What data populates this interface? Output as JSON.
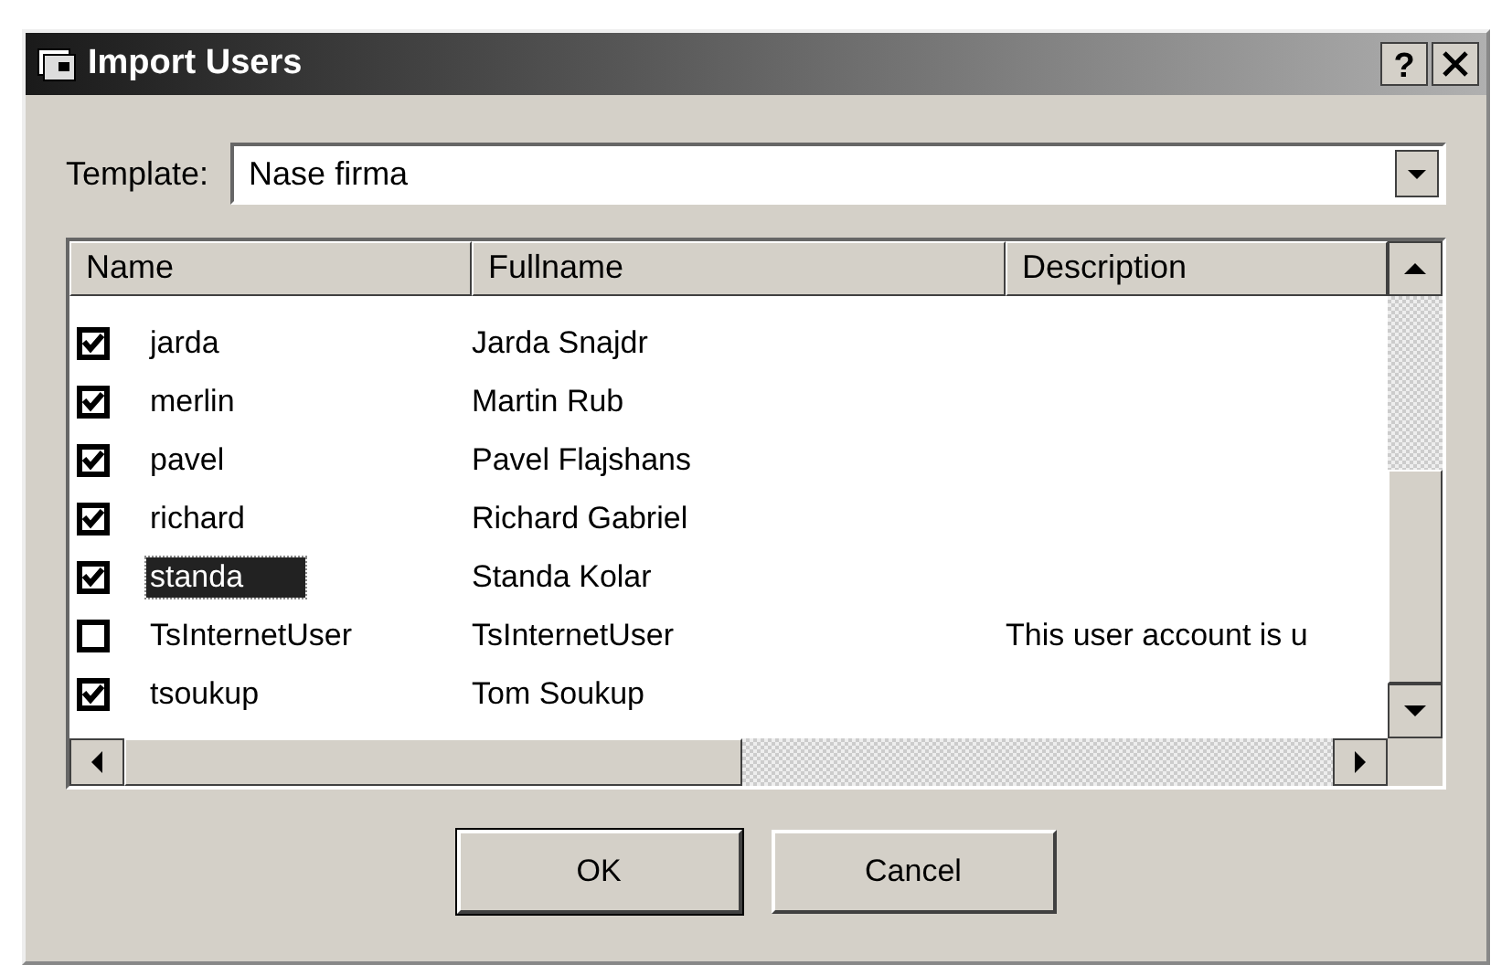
{
  "window": {
    "title": "Import Users",
    "help_button": "?"
  },
  "template": {
    "label": "Template:",
    "value": "Nase firma"
  },
  "table": {
    "columns": [
      "Name",
      "Fullname",
      "Description"
    ],
    "rows": [
      {
        "name": "jarda",
        "fullname": "Jarda Snajdr",
        "checked": true,
        "selected": false
      },
      {
        "name": "merlin",
        "fullname": "Martin Rub",
        "checked": true,
        "selected": false
      },
      {
        "name": "pavel",
        "fullname": "Pavel Flajshans",
        "checked": true,
        "selected": false
      },
      {
        "name": "richard",
        "fullname": "Richard Gabriel",
        "checked": true,
        "selected": false
      },
      {
        "name": "standa",
        "fullname": "Standa Kolar",
        "checked": true,
        "selected": true
      },
      {
        "name": "TsInternetUser",
        "fullname": "TsInternetUser",
        "description": "This user account is u",
        "checked": false,
        "selected": false
      },
      {
        "name": "tsoukup",
        "fullname": "Tom Soukup",
        "checked": true,
        "selected": false
      }
    ]
  },
  "buttons": [
    "OK",
    "Cancel"
  ]
}
